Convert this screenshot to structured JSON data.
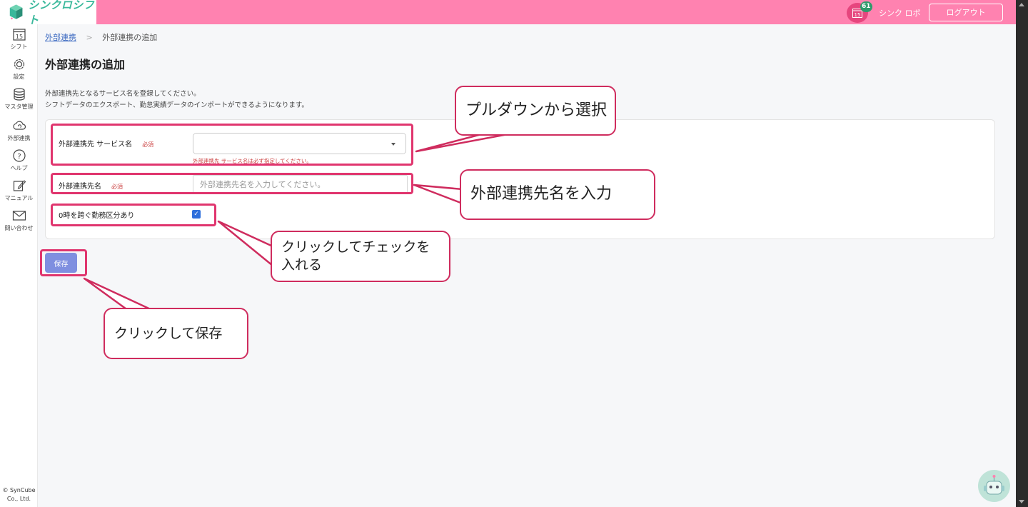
{
  "header": {
    "app_name": "シンクロシフト",
    "notification_count": "61",
    "calendar_day": "15",
    "user_name": "シンク ロボ",
    "logout_label": "ログアウト"
  },
  "sidebar": {
    "items": [
      {
        "label": "シフト",
        "icon": "calendar-icon",
        "day": "15"
      },
      {
        "label": "設定",
        "icon": "gear-icon"
      },
      {
        "label": "マスタ管理",
        "icon": "database-icon"
      },
      {
        "label": "外部連携",
        "icon": "cloud-sync-icon"
      },
      {
        "label": "ヘルプ",
        "icon": "help-icon"
      },
      {
        "label": "マニュアル",
        "icon": "edit-icon"
      },
      {
        "label": "問い合わせ",
        "icon": "mail-icon"
      }
    ],
    "copyright_1": "© SynCube",
    "copyright_2": "Co., Ltd."
  },
  "breadcrumb": {
    "parent": "外部連携",
    "separator": ">",
    "current": "外部連携の追加"
  },
  "page": {
    "title": "外部連携の追加",
    "desc_1": "外部連携先となるサービス名を登録してください。",
    "desc_2": "シフトデータのエクスポート、勤怠実績データのインポートができるようになります。"
  },
  "form": {
    "service_label": "外部連携先 サービス名",
    "required_label": "必須",
    "service_value": "",
    "service_error": "外部連携先 サービス名は必ず指定してください。",
    "name_label": "外部連携先名",
    "name_placeholder": "外部連携先名を入力してください。",
    "name_value": "",
    "overnight_label": "0時を跨ぐ勤務区分あり",
    "overnight_checked": true,
    "save_label": "保存"
  },
  "annotations": {
    "select": "プルダウンから選択",
    "input": "外部連携先名を入力",
    "check_1": "クリックしてチェックを",
    "check_2": "入れる",
    "save": "クリックして保存"
  },
  "colors": {
    "header": "#ff82b0",
    "annotation": "#e0356e",
    "checkbox": "#2f6fdc",
    "save_button": "#7f8fe0",
    "brand": "#39b89b"
  }
}
